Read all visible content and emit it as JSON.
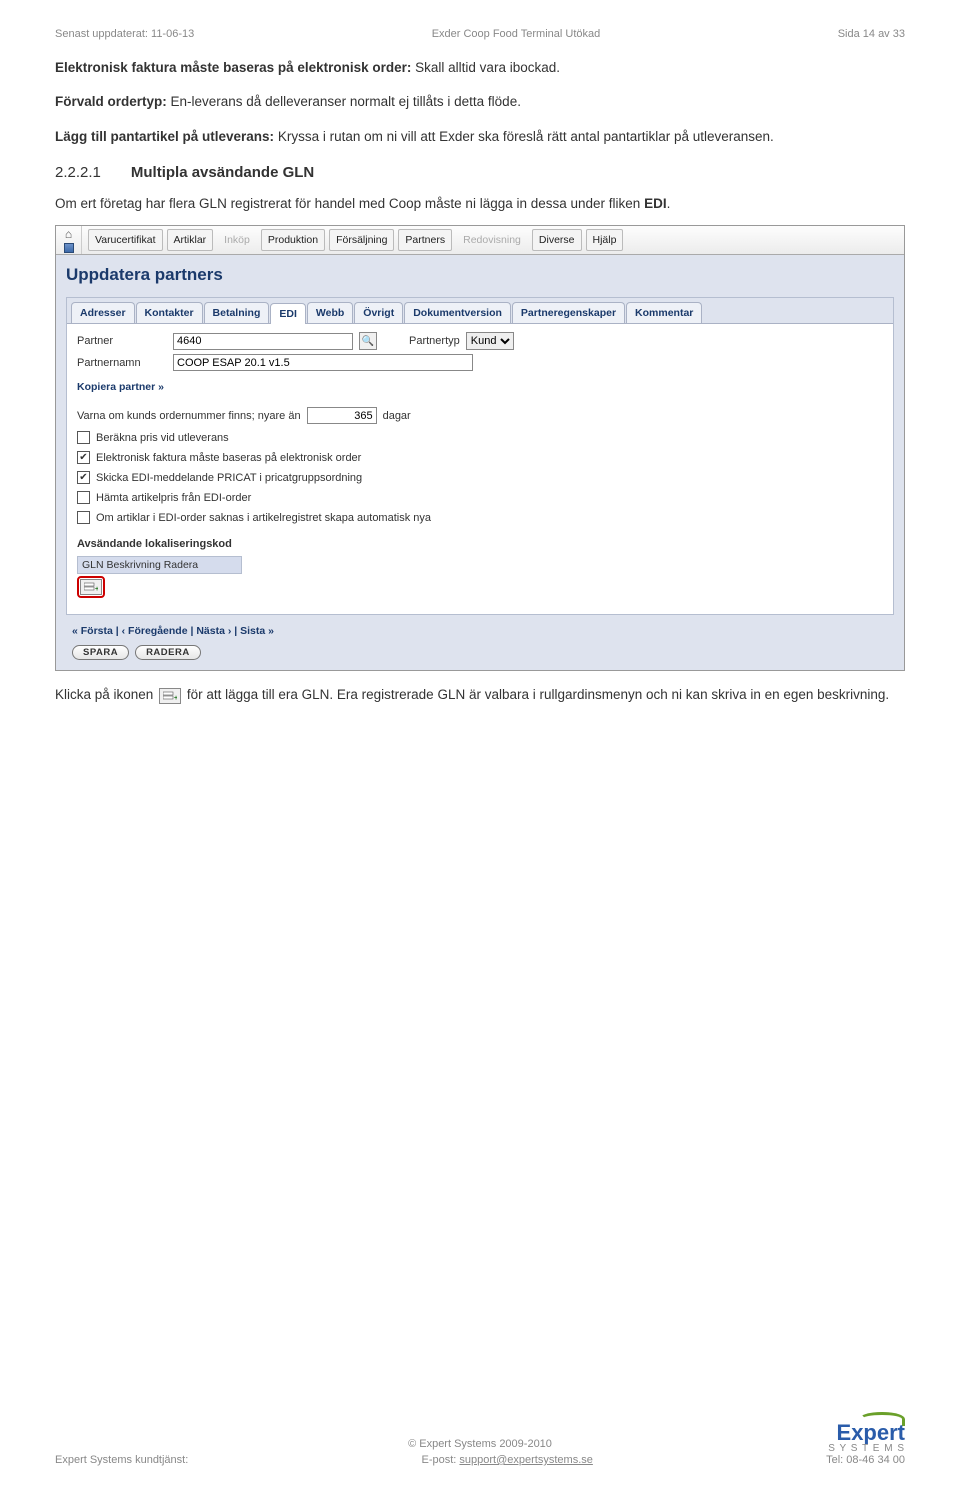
{
  "header": {
    "left": "Senast uppdaterat: 11-06-13",
    "center": "Exder Coop Food Terminal Utökad",
    "right": "Sida 14 av 33"
  },
  "para1_bold": "Elektronisk faktura måste baseras på elektronisk order:",
  "para1_rest": " Skall alltid vara ibockad.",
  "para2_bold": "Förvald ordertyp:",
  "para2_rest": " En-leverans då delleveranser normalt ej tillåts i detta flöde.",
  "para3_bold": "Lägg till pantartikel på utleverans:",
  "para3_rest": " Kryssa i rutan om ni vill att Exder ska föreslå rätt antal pantartiklar på utleveransen.",
  "section_num": "2.2.2.1",
  "section_title": "Multipla avsändande GLN",
  "para4_a": "Om ert företag har flera GLN registrerat för handel med Coop måste ni lägga in dessa under fliken ",
  "para4_bold": "EDI",
  "para4_b": ".",
  "menubar": {
    "items": [
      "Varucertifikat",
      "Artiklar",
      "Inköp",
      "Produktion",
      "Försäljning",
      "Partners",
      "Redovisning",
      "Diverse",
      "Hjälp"
    ]
  },
  "panel_title": "Uppdatera partners",
  "tabs": [
    "Adresser",
    "Kontakter",
    "Betalning",
    "EDI",
    "Webb",
    "Övrigt",
    "Dokumentversion",
    "Partneregenskaper",
    "Kommentar"
  ],
  "form": {
    "partner_label": "Partner",
    "partner_value": "4640",
    "partnertyp_label": "Partnertyp",
    "partnertyp_value": "Kund",
    "partnernamn_label": "Partnernamn",
    "partnernamn_value": "COOP ESAP 20.1 v1.5",
    "copy_link": "Kopiera partner »",
    "warn_prefix": "Varna om kunds ordernummer finns; nyare än",
    "warn_value": "365",
    "warn_suffix": "dagar",
    "chk1": "Beräkna pris vid utleverans",
    "chk2": "Elektronisk faktura måste baseras på elektronisk order",
    "chk3": "Skicka EDI-meddelande PRICAT i pricatgruppsordning",
    "chk4": "Hämta artikelpris från EDI-order",
    "chk5": "Om artiklar i EDI-order saknas i artikelregistret skapa automatisk nya",
    "sending_label": "Avsändande lokaliseringskod",
    "table_head": "GLN  Beskrivning  Radera"
  },
  "pager": "« Första  |  ‹ Föregående  |  Nästa ›  |  Sista »",
  "btn_save": "SPARA",
  "btn_delete": "RADERA",
  "para5_a": "Klicka på ikonen ",
  "para5_b": " för att lägga till era GLN. Era registrerade GLN är valbara i rullgardinsmenyn och ni kan skriva in en egen beskrivning.",
  "footer": {
    "copyright": "© Expert Systems 2009-2010",
    "left": "Expert Systems kundtjänst:",
    "mid_prefix": "E-post: ",
    "mid_link": "support@expertsystems.se",
    "right": "Tel: 08-46 34 00",
    "logo_main": "Expert",
    "logo_sub": "S Y S T E M S"
  }
}
